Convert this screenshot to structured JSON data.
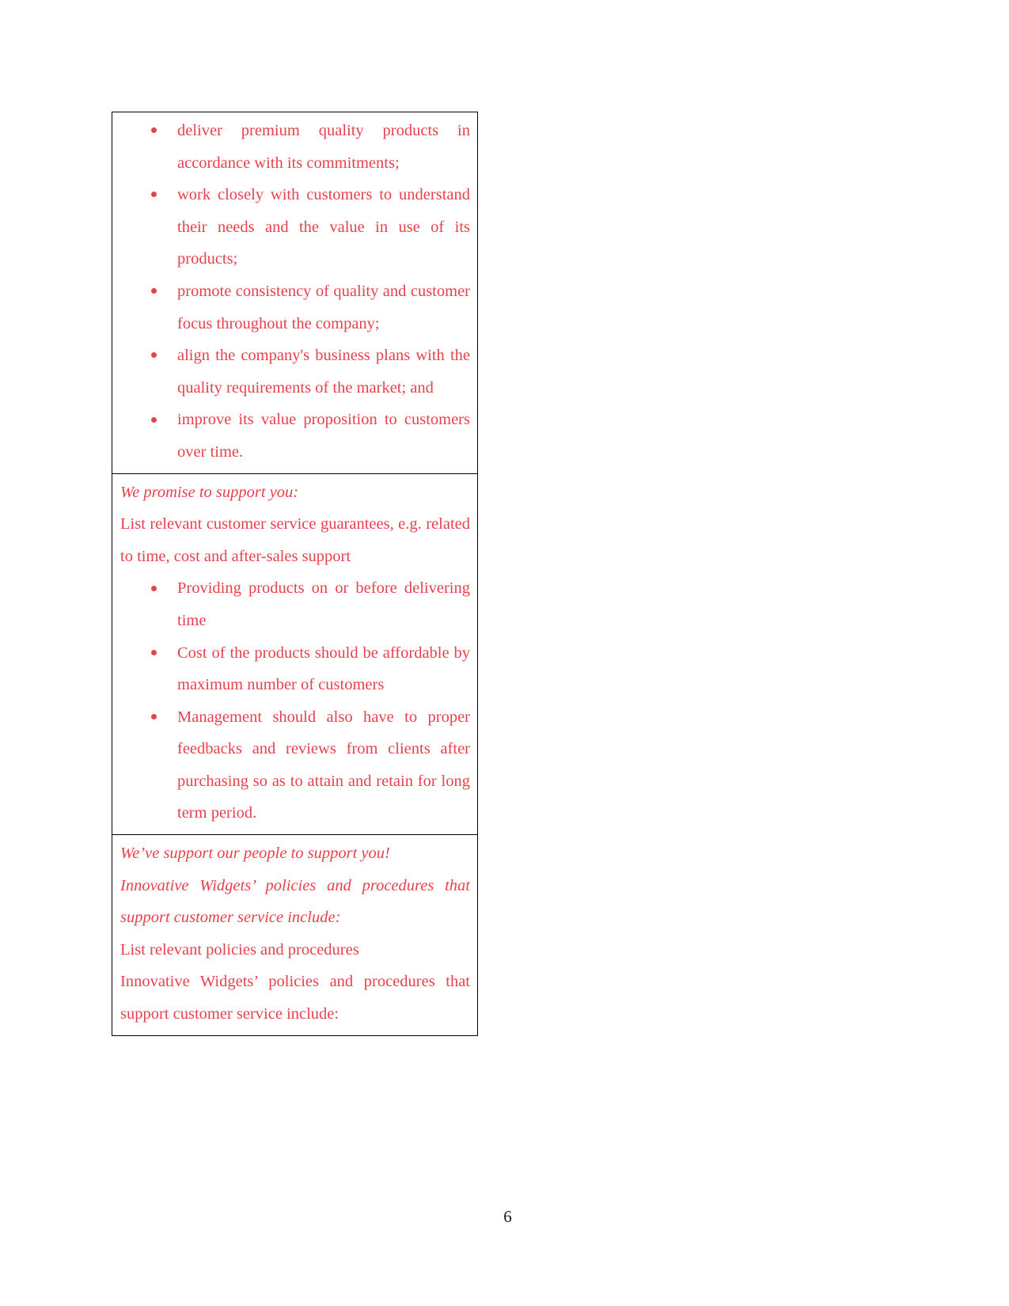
{
  "document": {
    "page_number": "6",
    "text_color": "#e8414c",
    "page_number_color": "#181818",
    "border_color": "#000000"
  },
  "table": {
    "rows": [
      {
        "id": "quality-commitments",
        "blocks": [
          {
            "type": "bullets",
            "items": [
              "deliver premium quality products in accordance with its commitments;",
              "work closely with customers to understand their needs and the value in use of its products;",
              "promote consistency of quality and customer focus throughout the company;",
              "align the company's business plans with the quality requirements of the market; and",
              "improve its value proposition to customers over time."
            ]
          }
        ]
      },
      {
        "id": "we-promise-to-support-you",
        "blocks": [
          {
            "type": "paragraph",
            "style": "italic",
            "align": "left",
            "text": "We promise to support you:"
          },
          {
            "type": "paragraph",
            "style": "regular",
            "align": "justify",
            "text": "List relevant customer service guarantees, e.g. related to time, cost and after-sales support"
          },
          {
            "type": "bullets",
            "items": [
              "Providing products on or before delivering time",
              "Cost of the products should be affordable by maximum number of customers",
              "Management should also have to proper feedbacks and reviews from clients after purchasing so as to attain and retain for long term period."
            ]
          }
        ]
      },
      {
        "id": "weve-support-our-people",
        "blocks": [
          {
            "type": "paragraph",
            "style": "italic",
            "align": "left",
            "text": "We’ve support our people to support you!"
          },
          {
            "type": "paragraph",
            "style": "italic",
            "align": "justify",
            "text": "Innovative Widgets’ policies and procedures that support customer service include:"
          },
          {
            "type": "paragraph",
            "style": "regular",
            "align": "left",
            "text": "List relevant policies and procedures"
          },
          {
            "type": "paragraph",
            "style": "regular",
            "align": "justify",
            "text": "Innovative Widgets’ policies and procedures that support customer service include:"
          }
        ]
      }
    ]
  }
}
